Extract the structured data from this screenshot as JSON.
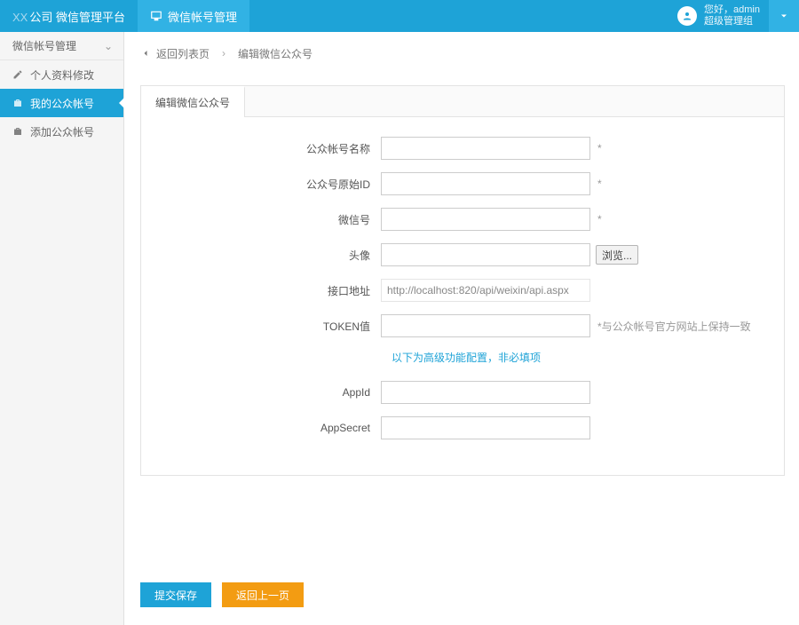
{
  "header": {
    "brand_prefix": "XX",
    "brand_suffix": "公司  微信管理平台",
    "tab_label": "微信帐号管理",
    "user_greeting": "您好，admin",
    "user_group": "超级管理组"
  },
  "sidebar": {
    "title": "微信帐号管理",
    "items": [
      {
        "label": "个人资料修改"
      },
      {
        "label": "我的公众帐号"
      },
      {
        "label": "添加公众帐号"
      }
    ]
  },
  "crumbs": {
    "back": "返回列表页",
    "current": "编辑微信公众号"
  },
  "panel": {
    "tab": "编辑微信公众号"
  },
  "form": {
    "labels": {
      "account_name": "公众帐号名称",
      "original_id": "公众号原始ID",
      "wechat_id": "微信号",
      "avatar": "头像",
      "api_url": "接口地址",
      "token": "TOKEN值",
      "app_id": "AppId",
      "app_secret": "AppSecret"
    },
    "values": {
      "account_name": "",
      "original_id": "",
      "wechat_id": "",
      "avatar": "",
      "api_url": "http://localhost:820/api/weixin/api.aspx",
      "token": "",
      "app_id": "",
      "app_secret": ""
    },
    "hints": {
      "required": "*",
      "token_hint": "*与公众帐号官方网站上保持一致"
    },
    "browse_label": "浏览...",
    "advanced_note": "以下为高级功能配置，非必填项"
  },
  "actions": {
    "submit": "提交保存",
    "back": "返回上一页"
  }
}
